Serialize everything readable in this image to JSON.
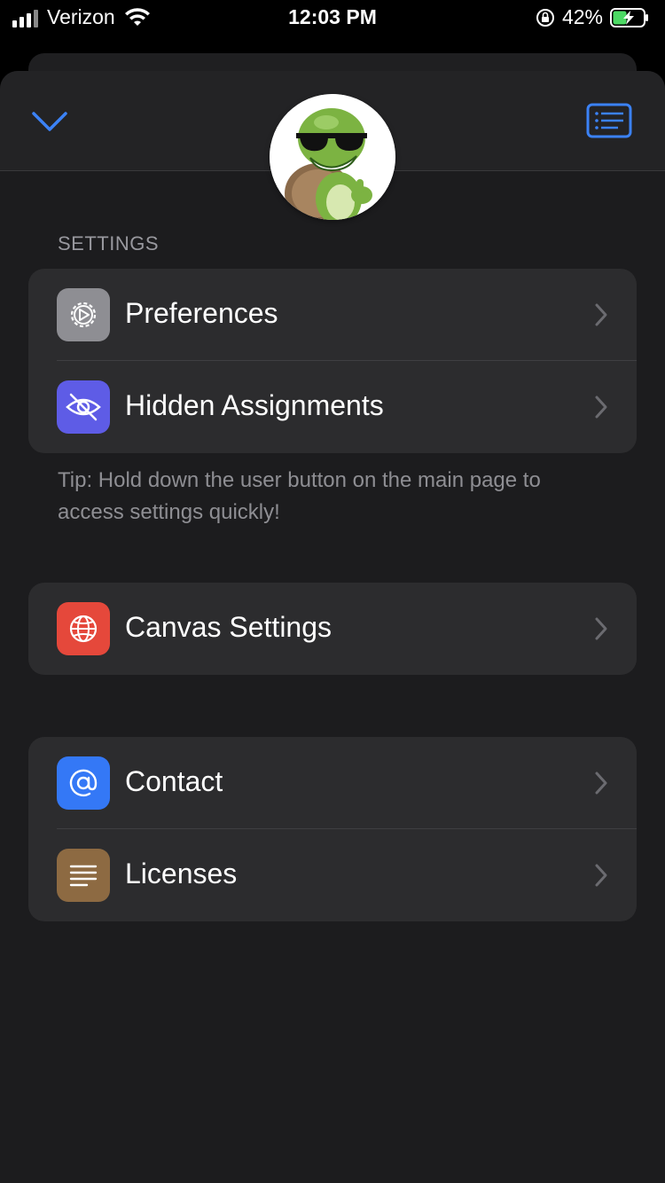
{
  "status_bar": {
    "carrier": "Verizon",
    "time": "12:03 PM",
    "battery_percent": "42%"
  },
  "header": {
    "collapse_icon": "chevron-down-icon",
    "list_icon": "list-icon",
    "accent_color": "#3b82f6"
  },
  "settings": {
    "section_title": "SETTINGS",
    "items": [
      {
        "label": "Preferences",
        "icon": "gear-icon",
        "color": "#8e8e93"
      },
      {
        "label": "Hidden Assignments",
        "icon": "eye-slash-icon",
        "color": "#5e5ce6"
      }
    ],
    "tip": "Tip: Hold down the user button on the main page to access settings quickly!"
  },
  "canvas": {
    "items": [
      {
        "label": "Canvas Settings",
        "icon": "globe-icon",
        "color": "#e5483b"
      }
    ]
  },
  "about": {
    "items": [
      {
        "label": "Contact",
        "icon": "at-icon",
        "color": "#3478f6"
      },
      {
        "label": "Licenses",
        "icon": "document-lines-icon",
        "color": "#8d6a42"
      }
    ]
  }
}
